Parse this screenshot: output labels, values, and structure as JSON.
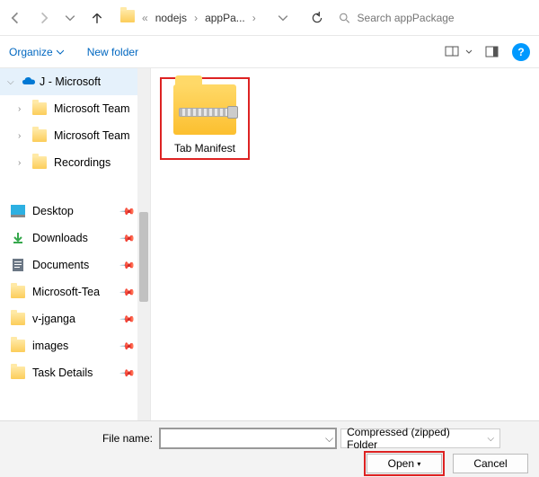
{
  "nav": {
    "breadcrumbs": [
      "nodejs",
      "appPa..."
    ]
  },
  "search": {
    "placeholder": "Search appPackage"
  },
  "toolbar": {
    "organize": "Organize",
    "newfolder": "New folder"
  },
  "tree": {
    "root": "J - Microsoft",
    "children": [
      "Microsoft Team",
      "Microsoft Team",
      "Recordings"
    ]
  },
  "quickaccess": [
    {
      "label": "Desktop",
      "icon": "desktop",
      "color": "#2db0e2",
      "pinned": true
    },
    {
      "label": "Downloads",
      "icon": "download",
      "color": "#36a84d",
      "pinned": true
    },
    {
      "label": "Documents",
      "icon": "document",
      "color": "#6b7785",
      "pinned": true
    },
    {
      "label": "Microsoft-Tea",
      "icon": "folder",
      "color": "#fccd5a",
      "pinned": true
    },
    {
      "label": "v-jganga",
      "icon": "folder",
      "color": "#fccd5a",
      "pinned": true
    },
    {
      "label": "images",
      "icon": "folder",
      "color": "#fccd5a",
      "pinned": true
    },
    {
      "label": "Task Details",
      "icon": "folder",
      "color": "#fccd5a",
      "pinned": true
    }
  ],
  "content": {
    "file": "Tab Manifest"
  },
  "footer": {
    "filename_label": "File name:",
    "filter": "Compressed (zipped) Folder",
    "open": "Open",
    "cancel": "Cancel"
  }
}
